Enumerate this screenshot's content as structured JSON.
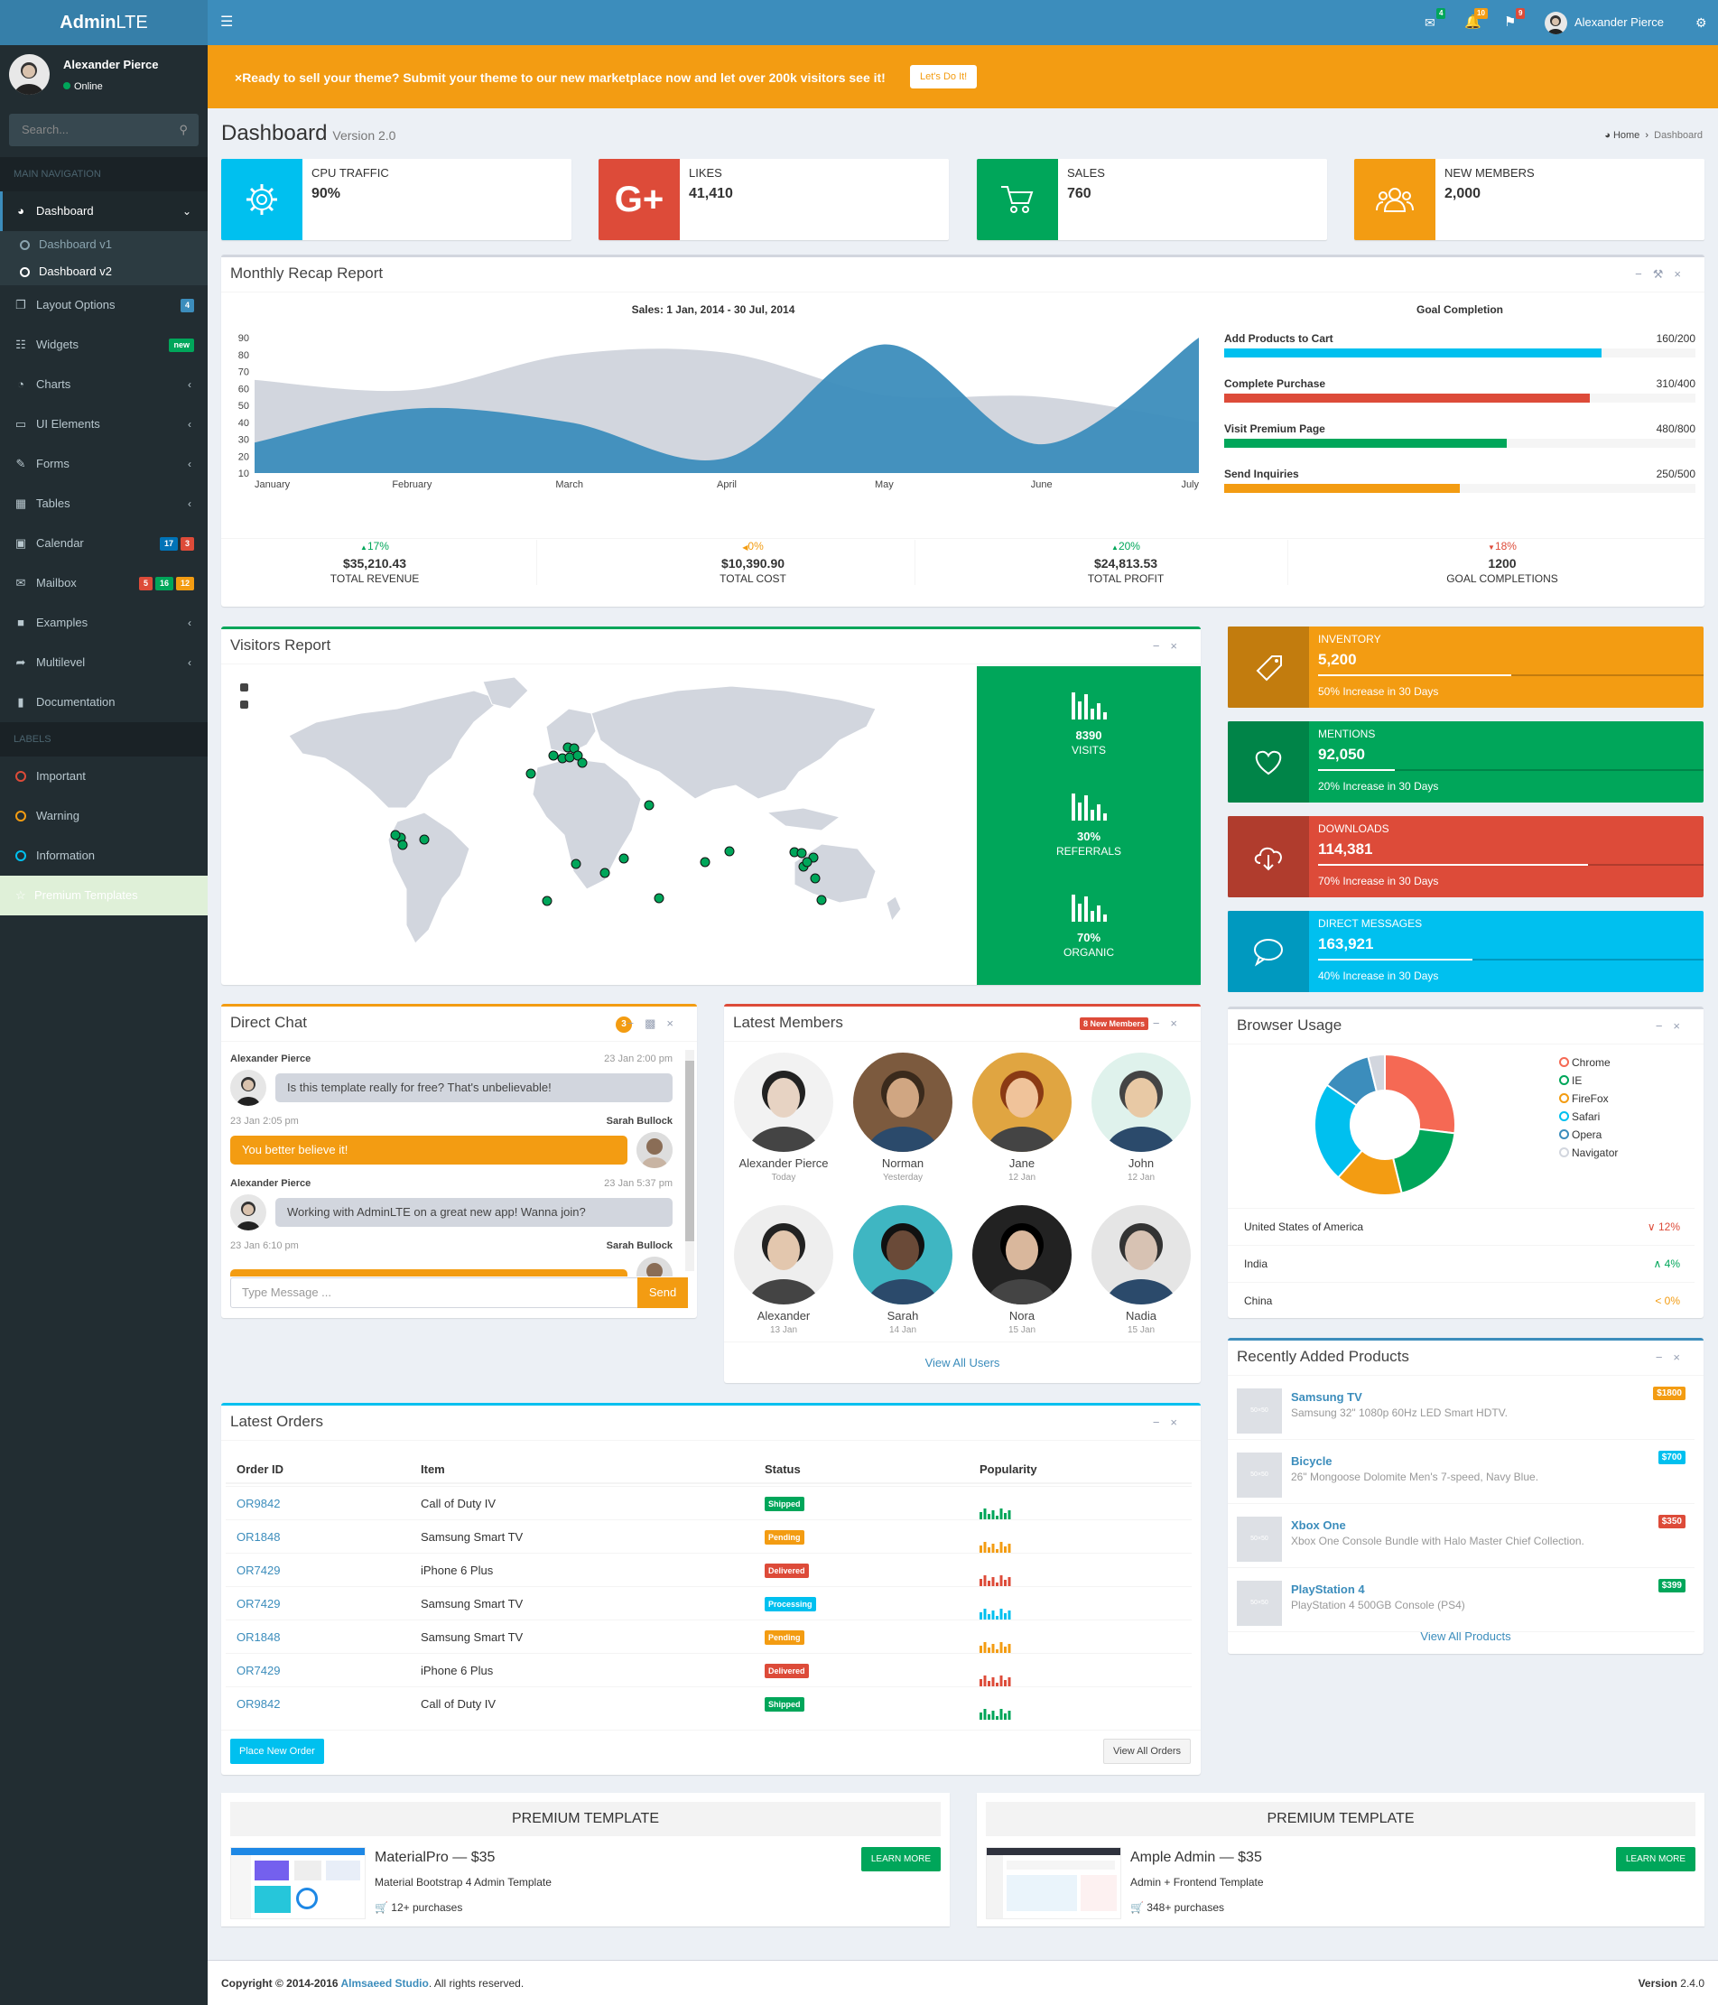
{
  "brand": {
    "bold": "Admin",
    "light": "LTE"
  },
  "user": {
    "name": "Alexander Pierce",
    "status": "Online"
  },
  "sidebar": {
    "search_placeholder": "Search...",
    "main_header": "MAIN NAVIGATION",
    "labels_header": "LABELS",
    "dashboard": "Dashboard",
    "sub": [
      "Dashboard v1",
      "Dashboard v2"
    ],
    "items": [
      {
        "label": "Layout Options",
        "icon": "files-icon",
        "badges": [
          {
            "t": "4",
            "c": "#3c8dbc"
          }
        ]
      },
      {
        "label": "Widgets",
        "icon": "th-icon",
        "badges": [
          {
            "t": "new",
            "c": "#00a65a"
          }
        ]
      },
      {
        "label": "Charts",
        "icon": "pie-chart-icon",
        "arrow": "‹"
      },
      {
        "label": "UI Elements",
        "icon": "laptop-icon",
        "arrow": "‹"
      },
      {
        "label": "Forms",
        "icon": "edit-icon",
        "arrow": "‹"
      },
      {
        "label": "Tables",
        "icon": "table-icon",
        "arrow": "‹"
      },
      {
        "label": "Calendar",
        "icon": "calendar-icon",
        "badges": [
          {
            "t": "17",
            "c": "#0073b7"
          },
          {
            "t": "3",
            "c": "#dd4b39"
          }
        ]
      },
      {
        "label": "Mailbox",
        "icon": "envelope-icon",
        "badges": [
          {
            "t": "5",
            "c": "#dd4b39"
          },
          {
            "t": "16",
            "c": "#00a65a"
          },
          {
            "t": "12",
            "c": "#f39c12"
          }
        ]
      },
      {
        "label": "Examples",
        "icon": "folder-icon",
        "arrow": "‹"
      },
      {
        "label": "Multilevel",
        "icon": "share-icon",
        "arrow": "‹"
      },
      {
        "label": "Documentation",
        "icon": "book-icon"
      }
    ],
    "labels": [
      {
        "label": "Important",
        "color": "#dd4b39"
      },
      {
        "label": "Warning",
        "color": "#f39c12"
      },
      {
        "label": "Information",
        "color": "#00c0ef"
      }
    ],
    "premium": "Premium Templates"
  },
  "topbar": {
    "user": "Alexander Pierce",
    "badges": {
      "messages": "4",
      "notifications": "10",
      "tasks": "9"
    }
  },
  "callout": {
    "text": "Ready to sell your theme? Submit your theme to our new marketplace now and let over 200k visitors see it!",
    "button": "Let's Do It!"
  },
  "page": {
    "title": "Dashboard",
    "version": "Version 2.0",
    "breadcrumb_home": "Home",
    "breadcrumb_current": "Dashboard"
  },
  "info_boxes": [
    {
      "title": "CPU TRAFFIC",
      "value": "90%",
      "pct": "%",
      "color": "#00c0ef",
      "icon": "gear-icon"
    },
    {
      "title": "LIKES",
      "value": "41,410",
      "color": "#dd4b39",
      "icon": "google-plus-icon"
    },
    {
      "title": "SALES",
      "value": "760",
      "color": "#00a65a",
      "icon": "cart-icon"
    },
    {
      "title": "NEW MEMBERS",
      "value": "2,000",
      "color": "#f39c12",
      "icon": "users-icon"
    }
  ],
  "recap": {
    "title": "Monthly Recap Report",
    "chart_title": "Sales: 1 Jan, 2014 - 30 Jul, 2014",
    "goal_title": "Goal Completion",
    "goals": [
      {
        "label": "Add Products to Cart",
        "value": "160/200",
        "fraction": 0.8,
        "color": "#00c0ef"
      },
      {
        "label": "Complete Purchase",
        "value": "310/400",
        "fraction": 0.775,
        "color": "#dd4b39"
      },
      {
        "label": "Visit Premium Page",
        "value": "480/800",
        "fraction": 0.6,
        "color": "#00a65a"
      },
      {
        "label": "Send Inquiries",
        "value": "250/500",
        "fraction": 0.5,
        "color": "#f39c12"
      }
    ],
    "stats": [
      {
        "pct": "17%",
        "dir": "up",
        "color": "#00a65a",
        "value": "$35,210.43",
        "label": "TOTAL REVENUE"
      },
      {
        "pct": "0%",
        "dir": "left",
        "color": "#f39c12",
        "value": "$10,390.90",
        "label": "TOTAL COST"
      },
      {
        "pct": "20%",
        "dir": "up",
        "color": "#00a65a",
        "value": "$24,813.53",
        "label": "TOTAL PROFIT"
      },
      {
        "pct": "18%",
        "dir": "down",
        "color": "#dd4b39",
        "value": "1200",
        "label": "GOAL COMPLETIONS"
      }
    ]
  },
  "chart_data": {
    "type": "area",
    "title": "Sales: 1 Jan, 2014 - 30 Jul, 2014",
    "categories": [
      "January",
      "February",
      "March",
      "April",
      "May",
      "June",
      "July"
    ],
    "ylim": [
      10,
      90
    ],
    "yticks": [
      10,
      20,
      30,
      40,
      50,
      60,
      70,
      80,
      90
    ],
    "series": [
      {
        "values": [
          65,
          59,
          80,
          81,
          56,
          55,
          40
        ],
        "color": "#d2d6de"
      },
      {
        "values": [
          28,
          48,
          40,
          19,
          86,
          27,
          90
        ],
        "color": "#3c8dbc"
      }
    ]
  },
  "visitors": {
    "title": "Visitors Report",
    "stats": [
      {
        "value": "8390",
        "label": "VISITS"
      },
      {
        "value": "30%",
        "label": "REFERRALS"
      },
      {
        "value": "70%",
        "label": "ORGANIC"
      }
    ]
  },
  "side_stats": [
    {
      "title": "INVENTORY",
      "value": "5,200",
      "desc": "50% Increase in 30 Days",
      "progress": 0.5,
      "color": "#f39c12",
      "icon": "tag-icon"
    },
    {
      "title": "MENTIONS",
      "value": "92,050",
      "desc": "20% Increase in 30 Days",
      "progress": 0.2,
      "color": "#00a65a",
      "icon": "heart-icon"
    },
    {
      "title": "DOWNLOADS",
      "value": "114,381",
      "desc": "70% Increase in 30 Days",
      "progress": 0.7,
      "color": "#dd4b39",
      "icon": "cloud-download-icon"
    },
    {
      "title": "DIRECT MESSAGES",
      "value": "163,921",
      "desc": "40% Increase in 30 Days",
      "progress": 0.4,
      "color": "#00c0ef",
      "icon": "comment-icon"
    }
  ],
  "chat": {
    "title": "Direct Chat",
    "count": "3",
    "placeholder": "Type Message ...",
    "send": "Send",
    "messages": [
      {
        "name": "Alexander Pierce",
        "time": "23 Jan 2:00 pm",
        "text": "Is this template really for free? That's unbelievable!",
        "side": "left"
      },
      {
        "name": "Sarah Bullock",
        "time": "23 Jan 2:05 pm",
        "text": "You better believe it!",
        "side": "right"
      },
      {
        "name": "Alexander Pierce",
        "time": "23 Jan 5:37 pm",
        "text": "Working with AdminLTE on a great new app! Wanna join?",
        "side": "left"
      },
      {
        "name": "Sarah Bullock",
        "time": "23 Jan 6:10 pm",
        "text": "",
        "side": "right"
      }
    ]
  },
  "members": {
    "title": "Latest Members",
    "badge": "8 New Members",
    "view_all": "View All Users",
    "list": [
      {
        "name": "Alexander Pierce",
        "date": "Today"
      },
      {
        "name": "Norman",
        "date": "Yesterday"
      },
      {
        "name": "Jane",
        "date": "12 Jan"
      },
      {
        "name": "John",
        "date": "12 Jan"
      },
      {
        "name": "Alexander",
        "date": "13 Jan"
      },
      {
        "name": "Sarah",
        "date": "14 Jan"
      },
      {
        "name": "Nora",
        "date": "15 Jan"
      },
      {
        "name": "Nadia",
        "date": "15 Jan"
      }
    ]
  },
  "browser": {
    "title": "Browser Usage",
    "legend": [
      {
        "label": "Chrome",
        "color": "#f56954",
        "share": 700
      },
      {
        "label": "IE",
        "color": "#00a65a",
        "share": 500
      },
      {
        "label": "FireFox",
        "color": "#f39c12",
        "share": 400
      },
      {
        "label": "Safari",
        "color": "#00c0ef",
        "share": 600
      },
      {
        "label": "Opera",
        "color": "#3c8dbc",
        "share": 300
      },
      {
        "label": "Navigator",
        "color": "#d2d6de",
        "share": 100
      }
    ],
    "countries": [
      {
        "name": "United States of America",
        "pct": "12%",
        "dir": "down",
        "color": "#dd4b39"
      },
      {
        "name": "India",
        "pct": "4%",
        "dir": "up",
        "color": "#00a65a"
      },
      {
        "name": "China",
        "pct": "0%",
        "dir": "left",
        "color": "#f39c12"
      }
    ]
  },
  "orders": {
    "title": "Latest Orders",
    "headers": [
      "Order ID",
      "Item",
      "Status",
      "Popularity"
    ],
    "rows": [
      {
        "id": "OR9842",
        "item": "Call of Duty IV",
        "status": "Shipped",
        "color": "#00a65a"
      },
      {
        "id": "OR1848",
        "item": "Samsung Smart TV",
        "status": "Pending",
        "color": "#f39c12"
      },
      {
        "id": "OR7429",
        "item": "iPhone 6 Plus",
        "status": "Delivered",
        "color": "#dd4b39"
      },
      {
        "id": "OR7429",
        "item": "Samsung Smart TV",
        "status": "Processing",
        "color": "#00c0ef"
      },
      {
        "id": "OR1848",
        "item": "Samsung Smart TV",
        "status": "Pending",
        "color": "#f39c12"
      },
      {
        "id": "OR7429",
        "item": "iPhone 6 Plus",
        "status": "Delivered",
        "color": "#dd4b39"
      },
      {
        "id": "OR9842",
        "item": "Call of Duty IV",
        "status": "Shipped",
        "color": "#00a65a"
      }
    ],
    "place": "Place New Order",
    "view_all": "View All Orders"
  },
  "products": {
    "title": "Recently Added Products",
    "view_all": "View All Products",
    "thumb": "50×50",
    "list": [
      {
        "name": "Samsung TV",
        "desc": "Samsung 32\" 1080p 60Hz LED Smart HDTV.",
        "price": "$1800",
        "color": "#f39c12"
      },
      {
        "name": "Bicycle",
        "desc": "26\" Mongoose Dolomite Men's 7-speed, Navy Blue.",
        "price": "$700",
        "color": "#00c0ef"
      },
      {
        "name": "Xbox One",
        "desc": "Xbox One Console Bundle with Halo Master Chief Collection.",
        "price": "$350",
        "color": "#dd4b39"
      },
      {
        "name": "PlayStation 4",
        "desc": "PlayStation 4 500GB Console (PS4)",
        "price": "$399",
        "color": "#00a65a"
      }
    ]
  },
  "promos": [
    {
      "header": "PREMIUM TEMPLATE",
      "title": "MaterialPro — $35",
      "sub": "Material Bootstrap 4 Admin Template",
      "count": "12+ purchases",
      "btn": "LEARN MORE"
    },
    {
      "header": "PREMIUM TEMPLATE",
      "title": "Ample Admin — $35",
      "sub": "Admin + Frontend Template",
      "count": "348+ purchases",
      "btn": "LEARN MORE"
    }
  ],
  "footer": {
    "copy": "Copyright © 2014-2016 ",
    "studio": "Almsaeed Studio",
    "rights": ". All rights reserved.",
    "version_label": "Version",
    "version": "2.4.0"
  }
}
